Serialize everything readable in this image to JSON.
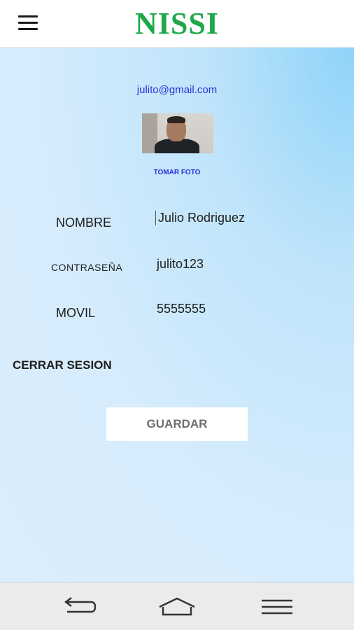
{
  "app": {
    "title": "NISSI"
  },
  "header": {
    "menu_icon": "hamburger-icon"
  },
  "profile": {
    "email": "julito@gmail.com",
    "take_photo_label": "TOMAR FOTO"
  },
  "form": {
    "name_label": "NOMBRE",
    "name_value": "Julio Rodriguez",
    "password_label": "CONTRASEÑA",
    "password_value": "julito123",
    "mobile_label": "MOVIL",
    "mobile_value": "5555555"
  },
  "actions": {
    "logout_label": "CERRAR SESION",
    "save_label": "GUARDAR"
  },
  "navbar": {
    "icons": [
      "back-icon",
      "home-icon",
      "recent-apps-icon"
    ]
  },
  "colors": {
    "brand": "#1fa84a",
    "link": "#2a34d8",
    "background": "#d6ecfc"
  }
}
